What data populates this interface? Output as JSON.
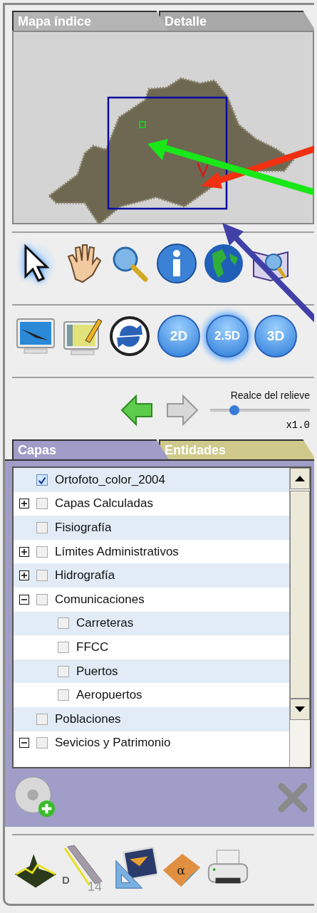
{
  "index_tabs": [
    {
      "label": "Mapa índice",
      "selected": true
    },
    {
      "label": "Detalle",
      "selected": false
    }
  ],
  "tools": [
    {
      "kind": "pointer",
      "selected": true
    },
    {
      "kind": "pan",
      "selected": false
    },
    {
      "kind": "zoom",
      "selected": false
    },
    {
      "kind": "info",
      "selected": false
    },
    {
      "kind": "globe",
      "selected": false
    },
    {
      "kind": "find",
      "selected": false
    }
  ],
  "actions": [
    {
      "kind": "overview"
    },
    {
      "kind": "edit"
    },
    {
      "kind": "refresh"
    }
  ],
  "view_modes": [
    {
      "label": "2D",
      "selected": false
    },
    {
      "label": "2.5D",
      "selected": true
    },
    {
      "label": "3D",
      "selected": false
    }
  ],
  "nav": [
    {
      "kind": "back",
      "disabled": false
    },
    {
      "kind": "forward",
      "disabled": true
    }
  ],
  "relief": {
    "label": "Realce del relieve",
    "level": 0.24,
    "reading": "x1.0"
  },
  "layer_tabs": [
    {
      "label": "Capas",
      "selected": true
    },
    {
      "label": "Entidades",
      "selected": false
    }
  ],
  "layers": [
    {
      "label": "Ortofoto_color_2004",
      "checked": true
    },
    {
      "label": "Capas Calculadas",
      "checked": false,
      "expanded": false
    },
    {
      "label": "Fisiografía",
      "checked": false
    },
    {
      "label": "Límites Administrativos",
      "checked": false,
      "expanded": false
    },
    {
      "label": "Hidrografía",
      "checked": false,
      "expanded": false
    },
    {
      "label": "Comunicaciones",
      "checked": false,
      "expanded": true,
      "children": [
        {
          "label": "Carreteras",
          "checked": false
        },
        {
          "label": "FFCC",
          "checked": false
        },
        {
          "label": "Puertos",
          "checked": false
        },
        {
          "label": "Aeropuertos",
          "checked": false
        }
      ]
    },
    {
      "label": "Poblaciones",
      "checked": false
    },
    {
      "label": "Sevicios y Patrimonio",
      "checked": false,
      "expanded": true
    }
  ],
  "ruler_mark": "D",
  "cube_symbol": "α",
  "page_number": "14"
}
